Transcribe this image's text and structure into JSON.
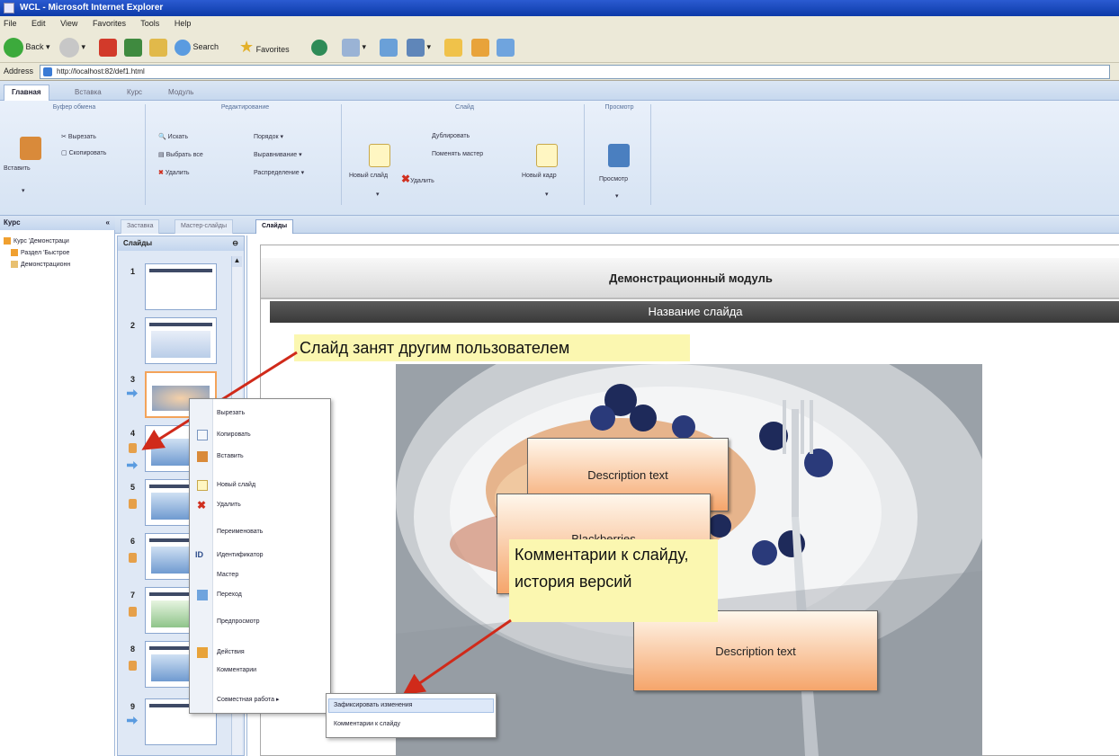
{
  "window": {
    "title": "WCL - Microsoft Internet Explorer"
  },
  "menubar": [
    "File",
    "Edit",
    "View",
    "Favorites",
    "Tools",
    "Help"
  ],
  "toolbar": {
    "back": "Back",
    "search": "Search",
    "favorites": "Favorites"
  },
  "address": {
    "label": "Address",
    "url": "http://localhost:82/def1.html"
  },
  "ribbon": {
    "tabs": [
      "Главная",
      "Вставка",
      "Курс",
      "Модуль"
    ],
    "groups": {
      "clipboard": {
        "title": "Буфер обмена",
        "paste": "Вставить",
        "cut": "Вырезать",
        "copy": "Скопировать"
      },
      "editing": {
        "title": "Редактирование",
        "find": "Искать",
        "select_all": "Выбрать все",
        "delete": "Удалить",
        "order": "Порядок ▾",
        "align": "Выравнивание ▾",
        "distribute": "Распределение ▾"
      },
      "slide": {
        "title": "Слайд",
        "new_slide": "Новый слайд",
        "duplicate": "Дублировать",
        "change_master": "Поменять мастер",
        "delete": "Удалить",
        "new_frame": "Новый кадр"
      },
      "view": {
        "title": "Просмотр",
        "preview": "Просмотр"
      }
    }
  },
  "left_panel": {
    "title": "Курс",
    "items": [
      "Курс 'Демонстраци",
      "Раздел 'Быстрое",
      "Демонстрационн"
    ]
  },
  "doc_tabs": [
    "Заставка",
    "Мастер-слайды",
    "Слайды"
  ],
  "slides_panel": {
    "title": "Слайды",
    "numbers": [
      "1",
      "2",
      "3",
      "4",
      "5",
      "6",
      "7",
      "8",
      "9"
    ]
  },
  "slide": {
    "module_title": "Демонстрационный модуль",
    "slide_title": "Название слайда",
    "desc1": "Description text",
    "desc2": "Blackberries",
    "desc3": "Description text"
  },
  "callouts": {
    "locked": "Слайд занят другим пользователем",
    "comments": "Комментарии к слайду, история версий"
  },
  "context_menu": {
    "items": [
      "Вырезать",
      "Копировать",
      "Вставить",
      "Новый слайд",
      "Удалить",
      "Переименовать",
      "Идентификатор",
      "Мастер",
      "Переход",
      "Предпросмотр",
      "Действия",
      "Комментарии",
      "Совместная работа"
    ],
    "id_label": "ID"
  },
  "submenu": {
    "items": [
      "Зафиксировать изменения",
      "Комментарии к слайду"
    ]
  }
}
